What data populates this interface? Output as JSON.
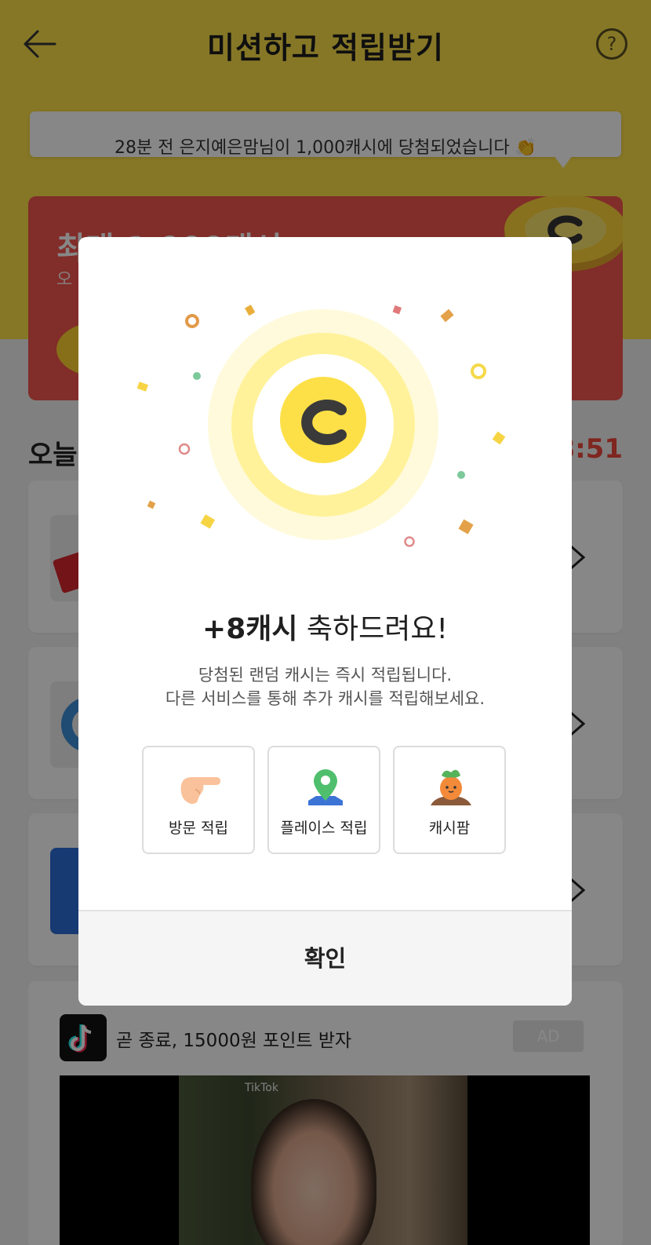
{
  "header": {
    "title": "미션하고 적립받기",
    "help_label": "?"
  },
  "ticker": {
    "text": "28분 전 은지예은맘님이 1,000캐시에 당첨되었습니다 👏"
  },
  "promo": {
    "title": "최대 1,000캐시",
    "subtitle": "오"
  },
  "today": {
    "label": "오늘",
    "timer": "8:51"
  },
  "ad": {
    "text": "곧 종료, 15000원 포인트 받자",
    "badge": "AD",
    "watermark": "TikTok"
  },
  "modal": {
    "amount": "+8캐시",
    "congrats": " 축하드려요!",
    "desc_line1": "당첨된 랜덤 캐시는 즉시 적립됩니다.",
    "desc_line2": "다른 서비스를 통해 추가 캐시를 적립해보세요.",
    "coin_letter": "C",
    "services": [
      {
        "label": "방문 적립",
        "icon": "pointing-hand-icon"
      },
      {
        "label": "플레이스 적립",
        "icon": "map-pin-icon"
      },
      {
        "label": "캐시팜",
        "icon": "carrot-icon"
      }
    ],
    "confirm_label": "확인"
  },
  "colors": {
    "brand_yellow": "#fde04a",
    "promo_red": "#f4564e",
    "timer_red": "#f0493e",
    "coin_yellow": "#fde047"
  }
}
